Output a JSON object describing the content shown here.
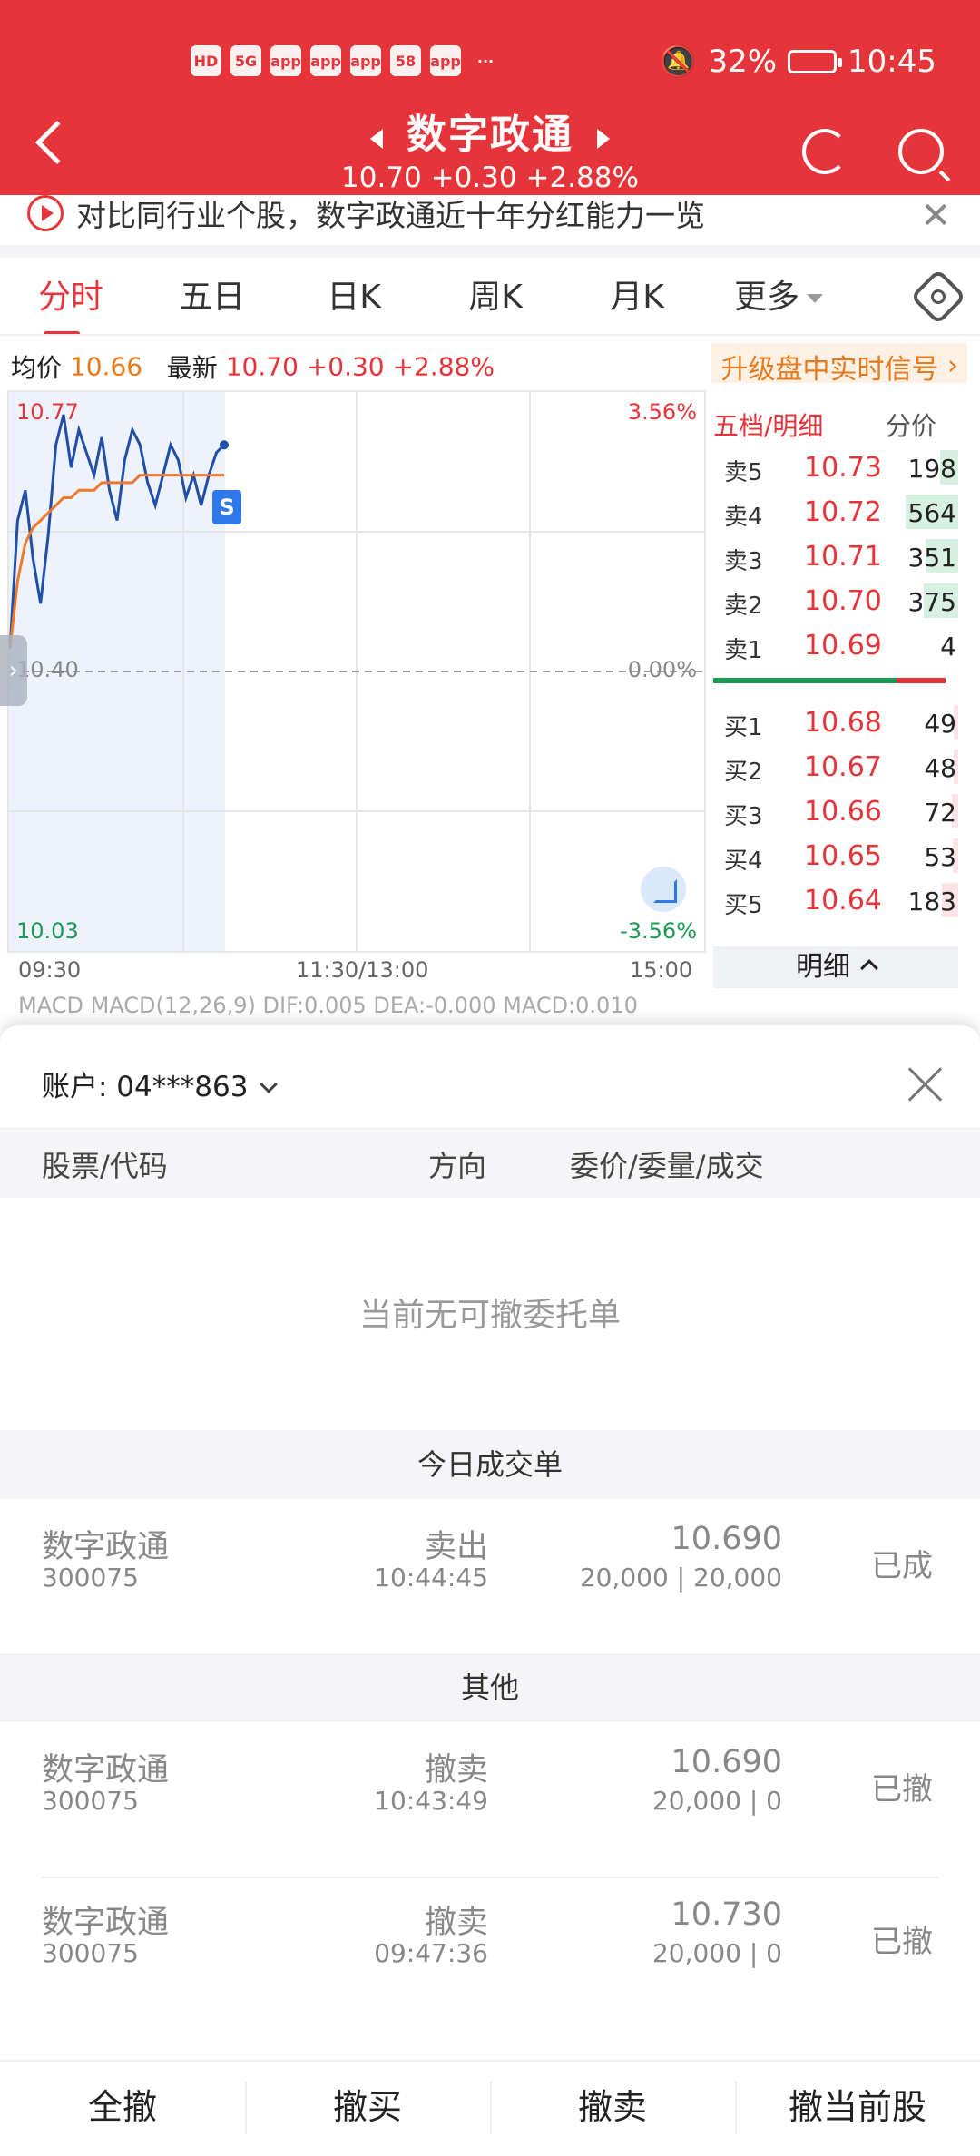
{
  "status_bar": {
    "left_icons": [
      "HD",
      "5G",
      "app",
      "app",
      "app",
      "58",
      "app",
      "···"
    ],
    "battery": "32%",
    "time": "10:45"
  },
  "header": {
    "title": "数字政通",
    "quote": "10.70 +0.30 +2.88%"
  },
  "banner": {
    "text": "对比同行业个股，数字政通近十年分红能力一览"
  },
  "tabs": [
    "分时",
    "五日",
    "日K",
    "周K",
    "月K",
    "更多"
  ],
  "price_bar": {
    "avg_label": "均价",
    "avg_value": "10.66",
    "last_label": "最新",
    "last_value": "10.70",
    "change": "+0.30",
    "change_pct": "+2.88%",
    "signal": "升级盘中实时信号"
  },
  "chart_labels": {
    "y_top": "10.77",
    "y_mid": "10.40",
    "y_bottom": "10.03",
    "pct_top": "3.56%",
    "pct_mid": "0.00%",
    "pct_bottom": "-3.56%",
    "x_start": "09:30",
    "x_mid": "11:30/13:00",
    "x_end": "15:00",
    "badge": "S"
  },
  "chart_data": {
    "type": "line",
    "title": "",
    "xlabel": "",
    "ylabel": "",
    "x_ticks": [
      "09:30",
      "11:30/13:00",
      "15:00"
    ],
    "ylim": [
      10.03,
      10.77
    ],
    "pct_ticks": [
      "3.56%",
      "0.00%",
      "-3.56%"
    ],
    "prev_close": 10.4,
    "grid": true,
    "series": [
      {
        "name": "",
        "color": "#1f4fa8",
        "values": [
          10.43,
          10.6,
          10.64,
          10.55,
          10.49,
          10.58,
          10.7,
          10.74,
          10.67,
          10.72,
          10.69,
          10.66,
          10.71,
          10.64,
          10.6,
          10.68,
          10.72,
          10.7,
          10.65,
          10.62,
          10.66,
          10.7,
          10.68,
          10.63,
          10.66,
          10.62,
          10.66,
          10.69,
          10.7
        ]
      },
      {
        "name": "",
        "color": "#f07a2c",
        "values": [
          10.43,
          10.52,
          10.57,
          10.59,
          10.6,
          10.61,
          10.62,
          10.63,
          10.63,
          10.64,
          10.64,
          10.64,
          10.65,
          10.65,
          10.65,
          10.65,
          10.65,
          10.66,
          10.66,
          10.66,
          10.66,
          10.66,
          10.66,
          10.66,
          10.66,
          10.66,
          10.66,
          10.66,
          10.66
        ]
      }
    ]
  },
  "order_book": {
    "tab_left": "五档/明细",
    "tab_right": "分价",
    "asks": [
      {
        "label": "卖5",
        "price": "10.73",
        "qty": "198",
        "depth": 0.25
      },
      {
        "label": "卖4",
        "price": "10.72",
        "qty": "564",
        "depth": 0.72
      },
      {
        "label": "卖3",
        "price": "10.71",
        "qty": "351",
        "depth": 0.45
      },
      {
        "label": "卖2",
        "price": "10.70",
        "qty": "375",
        "depth": 0.48
      },
      {
        "label": "卖1",
        "price": "10.69",
        "qty": "4",
        "depth": 0.0
      }
    ],
    "bids": [
      {
        "label": "买1",
        "price": "10.68",
        "qty": "49",
        "depth": 0.06
      },
      {
        "label": "买2",
        "price": "10.67",
        "qty": "48",
        "depth": 0.06
      },
      {
        "label": "买3",
        "price": "10.66",
        "qty": "72",
        "depth": 0.09
      },
      {
        "label": "买4",
        "price": "10.65",
        "qty": "53",
        "depth": 0.07
      },
      {
        "label": "买5",
        "price": "10.64",
        "qty": "183",
        "depth": 0.23
      }
    ],
    "detail_label": "明细"
  },
  "macd_strip": "MACD  MACD(12,26,9) DIF:0.005 DEA:-0.000 MACD:0.010",
  "sheet": {
    "account_label": "账户:  04***863",
    "columns": [
      "股票/代码",
      "方向",
      "委价/委量/成交"
    ],
    "empty_text": "当前无可撤委托单",
    "section_today": "今日成交单",
    "section_other": "其他",
    "today_orders": [
      {
        "name": "数字政通",
        "code": "300075",
        "dir": "卖出",
        "time": "10:44:45",
        "price": "10.690",
        "qty": "20,000 | 20,000",
        "status": "已成"
      }
    ],
    "other_orders": [
      {
        "name": "数字政通",
        "code": "300075",
        "dir": "撤卖",
        "time": "10:43:49",
        "price": "10.690",
        "qty": "20,000 | 0",
        "status": "已撤"
      },
      {
        "name": "数字政通",
        "code": "300075",
        "dir": "撤卖",
        "time": "09:47:36",
        "price": "10.730",
        "qty": "20,000 | 0",
        "status": "已撤"
      }
    ],
    "actions": [
      "全撤",
      "撤买",
      "撤卖",
      "撤当前股"
    ]
  }
}
